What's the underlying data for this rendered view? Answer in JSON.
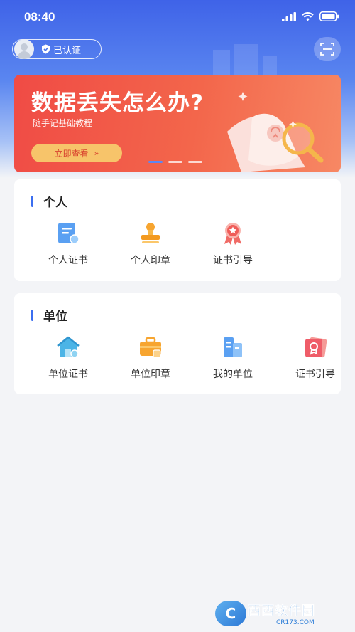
{
  "status_bar": {
    "time": "08:40"
  },
  "header": {
    "verified_label": "已认证",
    "icons": {
      "avatar": "user-avatar",
      "verified": "shield-check-icon",
      "scan": "scan-icon"
    }
  },
  "banner": {
    "title": "数据丢失怎么办?",
    "subtitle": "随手记基础教程",
    "cta_label": "立即查看",
    "cta_chevron": "»",
    "slides_total": 3,
    "active_slide": 1
  },
  "sections": {
    "personal": {
      "title": "个人",
      "items": [
        {
          "label": "个人证书",
          "icon": "certificate-icon"
        },
        {
          "label": "个人印章",
          "icon": "stamp-icon"
        },
        {
          "label": "证书引导",
          "icon": "medal-icon"
        }
      ]
    },
    "unit": {
      "title": "单位",
      "items": [
        {
          "label": "单位证书",
          "icon": "house-icon"
        },
        {
          "label": "单位印章",
          "icon": "briefcase-icon"
        },
        {
          "label": "我的单位",
          "icon": "building-icon"
        },
        {
          "label": "证书引导",
          "icon": "certificate-card-icon"
        }
      ]
    }
  },
  "watermark": {
    "logo_text": "C",
    "name": "西西软件园",
    "url": "CR173.COM"
  },
  "colors": {
    "primary_blue": "#3b6ef0",
    "banner_red": "#f04b45",
    "cta_yellow": "#f7c46a",
    "background": "#f3f4f7"
  }
}
